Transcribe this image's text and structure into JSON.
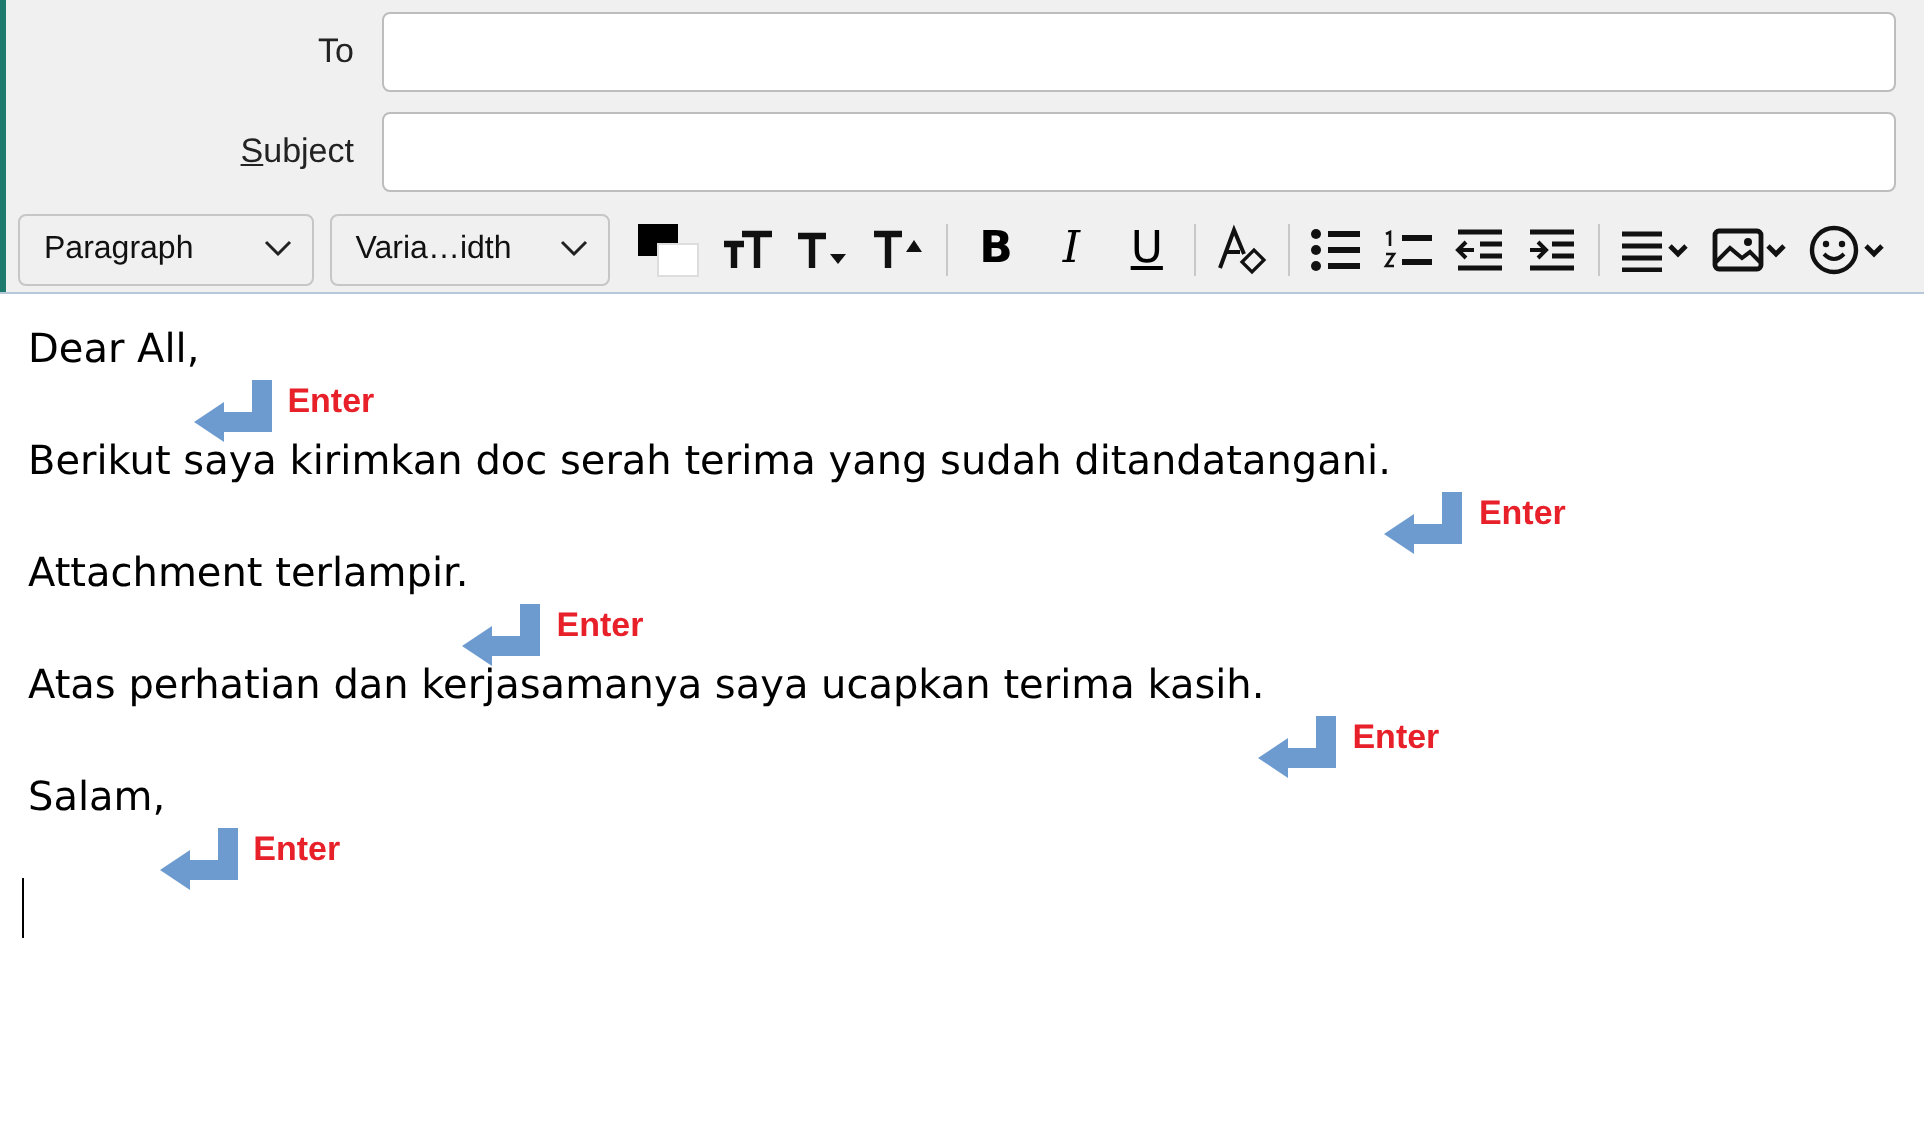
{
  "header_fields": [
    {
      "label": "To"
    },
    {
      "access_key": "S",
      "label": "ubject"
    }
  ],
  "toolbar": {
    "paragraph_format": "Paragraph",
    "font": "Varia…idth",
    "style_buttons": [
      "B",
      "I",
      "U"
    ]
  },
  "body": {
    "lines": [
      {
        "text": "Dear All,",
        "annotation": "Enter"
      },
      {
        "text": "Berikut saya kirimkan doc serah terima yang sudah ditandatangani.",
        "annotation": "Enter"
      },
      {
        "text": "Attachment terlampir.",
        "annotation": "Enter"
      },
      {
        "text": "Atas perhatian dan kerjasamanya saya ucapkan terima kasih.",
        "annotation": "Enter"
      },
      {
        "text": "Salam,",
        "annotation": "Enter"
      }
    ]
  }
}
